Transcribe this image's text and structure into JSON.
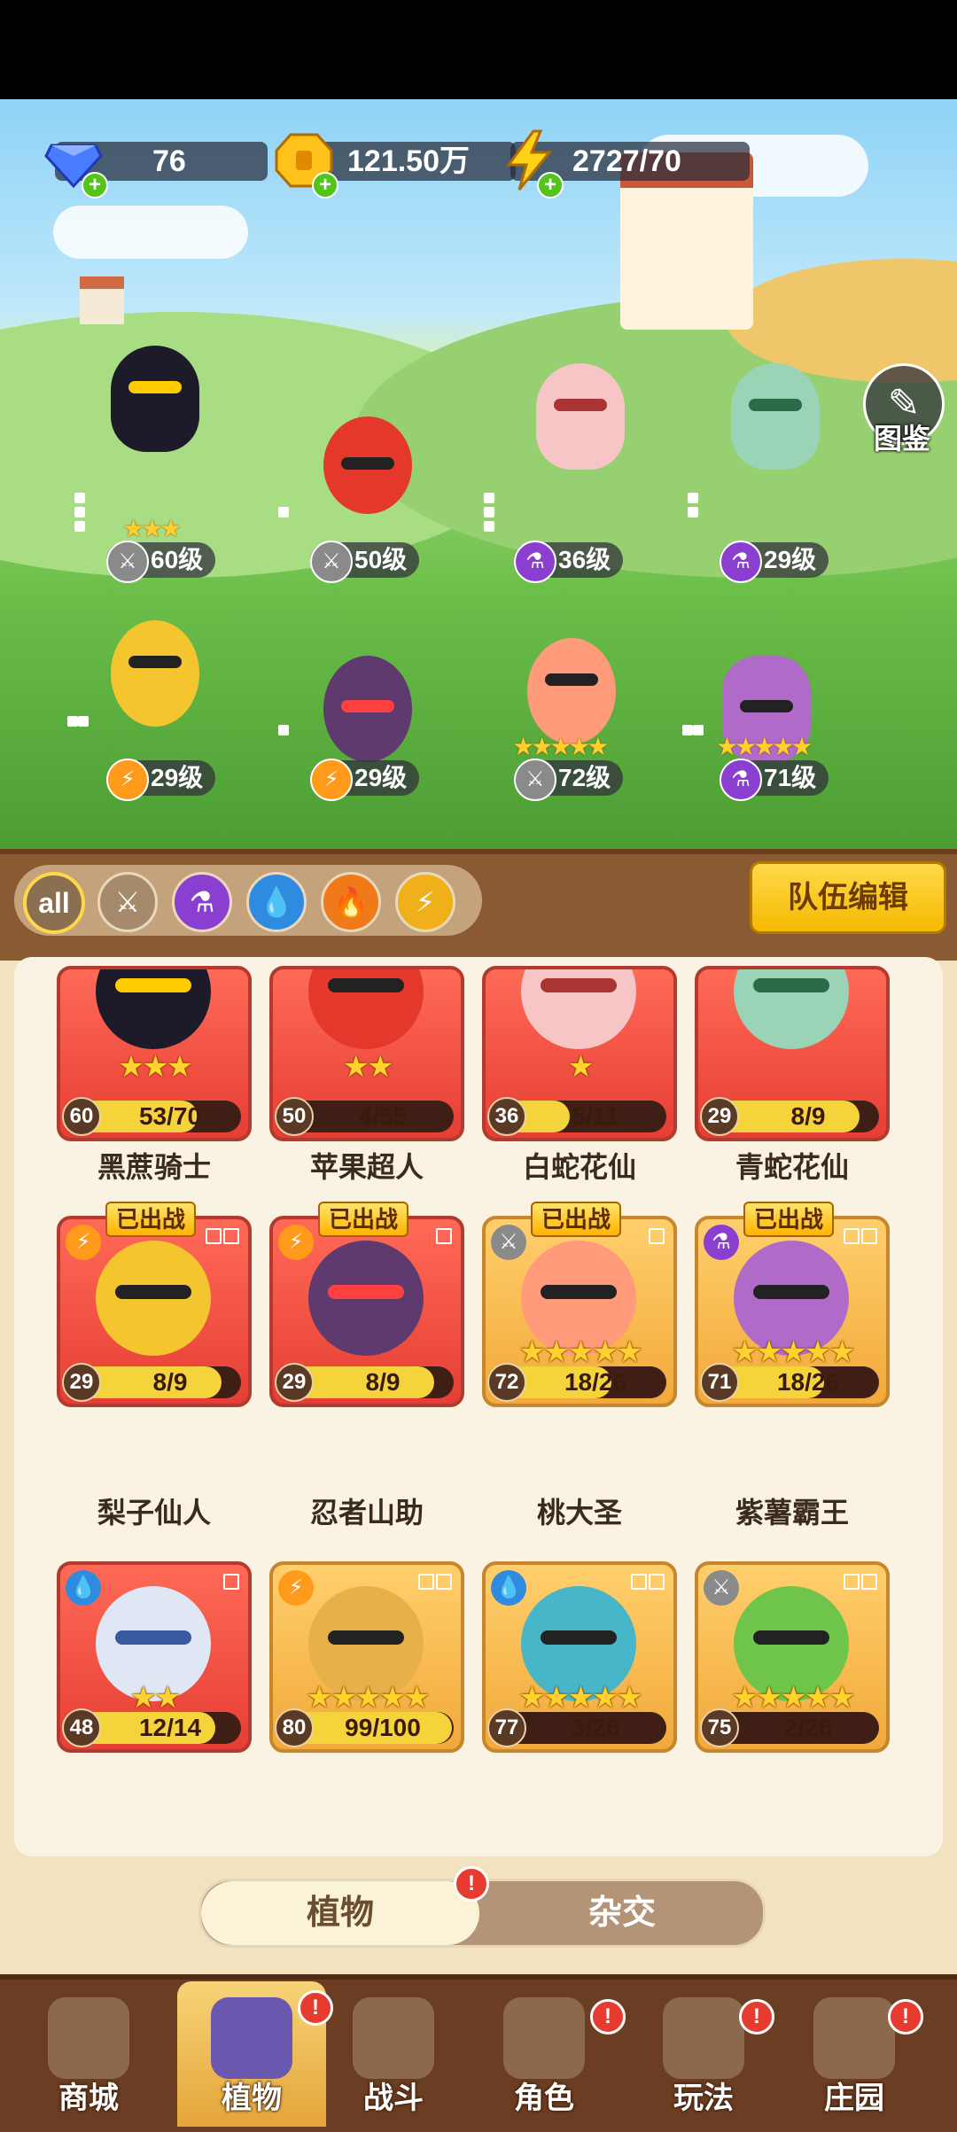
{
  "resources": {
    "gems": "76",
    "gold": "121.50万",
    "energy": "2727/70"
  },
  "atlas_label": "图鉴",
  "team": [
    {
      "name": "黑蔗骑士",
      "level": "60级",
      "element": "sword-icon"
    },
    {
      "name": "苹果超人",
      "level": "50级",
      "element": "sword-icon"
    },
    {
      "name": "白蛇花仙",
      "level": "36级",
      "element": "potion-icon"
    },
    {
      "name": "青蛇花仙",
      "level": "29级",
      "element": "potion-icon"
    },
    {
      "name": "梨子仙人",
      "level": "29级",
      "element": "lightning-icon"
    },
    {
      "name": "忍者山助",
      "level": "29级",
      "element": "lightning-icon"
    },
    {
      "name": "桃大圣",
      "level": "72级",
      "element": "sword-icon"
    },
    {
      "name": "紫薯霸王",
      "level": "71级",
      "element": "potion-icon"
    }
  ],
  "filters": [
    "all",
    "sword-icon",
    "potion-icon",
    "water-icon",
    "fire-icon",
    "lightning-icon"
  ],
  "team_edit_label": "队伍编辑",
  "deployed_label": "已出战",
  "cards": [
    {
      "name": "黑蔗骑士",
      "lv": "60",
      "count": "53/70",
      "progress": 0.757,
      "stars": 3,
      "style": "red"
    },
    {
      "name": "苹果超人",
      "lv": "50",
      "count": "4/55",
      "progress": 0.073,
      "stars": 2,
      "style": "red"
    },
    {
      "name": "白蛇花仙",
      "lv": "36",
      "count": "5/11",
      "progress": 0.455,
      "stars": 1,
      "style": "red"
    },
    {
      "name": "青蛇花仙",
      "lv": "29",
      "count": "8/9",
      "progress": 0.889,
      "stars": 0,
      "style": "red"
    },
    {
      "name": "梨子仙人",
      "lv": "29",
      "count": "8/9",
      "progress": 0.889,
      "stars": 0,
      "style": "red",
      "deployed": true
    },
    {
      "name": "忍者山助",
      "lv": "29",
      "count": "8/9",
      "progress": 0.889,
      "stars": 0,
      "style": "red",
      "deployed": true
    },
    {
      "name": "桃大圣",
      "lv": "72",
      "count": "18/26",
      "progress": 0.692,
      "stars": 5,
      "style": "gold",
      "deployed": true
    },
    {
      "name": "紫薯霸王",
      "lv": "71",
      "count": "18/26",
      "progress": 0.692,
      "stars": 5,
      "style": "gold",
      "deployed": true
    },
    {
      "name": "",
      "lv": "48",
      "count": "12/14",
      "progress": 0.857,
      "stars": 2,
      "style": "red"
    },
    {
      "name": "",
      "lv": "80",
      "count": "99/100",
      "progress": 0.99,
      "stars": 5,
      "style": "gold"
    },
    {
      "name": "",
      "lv": "77",
      "count": "3/26",
      "progress": 0.115,
      "stars": 5,
      "style": "gold"
    },
    {
      "name": "",
      "lv": "75",
      "count": "2/26",
      "progress": 0.077,
      "stars": 5,
      "style": "gold"
    }
  ],
  "toggle": {
    "plant": "植物",
    "cross": "杂交"
  },
  "nav": [
    {
      "label": "商城",
      "badge": false
    },
    {
      "label": "植物",
      "badge": true,
      "active": true
    },
    {
      "label": "战斗",
      "badge": false
    },
    {
      "label": "角色",
      "badge": true
    },
    {
      "label": "玩法",
      "badge": true
    },
    {
      "label": "庄园",
      "badge": true
    }
  ],
  "badge_mark": "!"
}
